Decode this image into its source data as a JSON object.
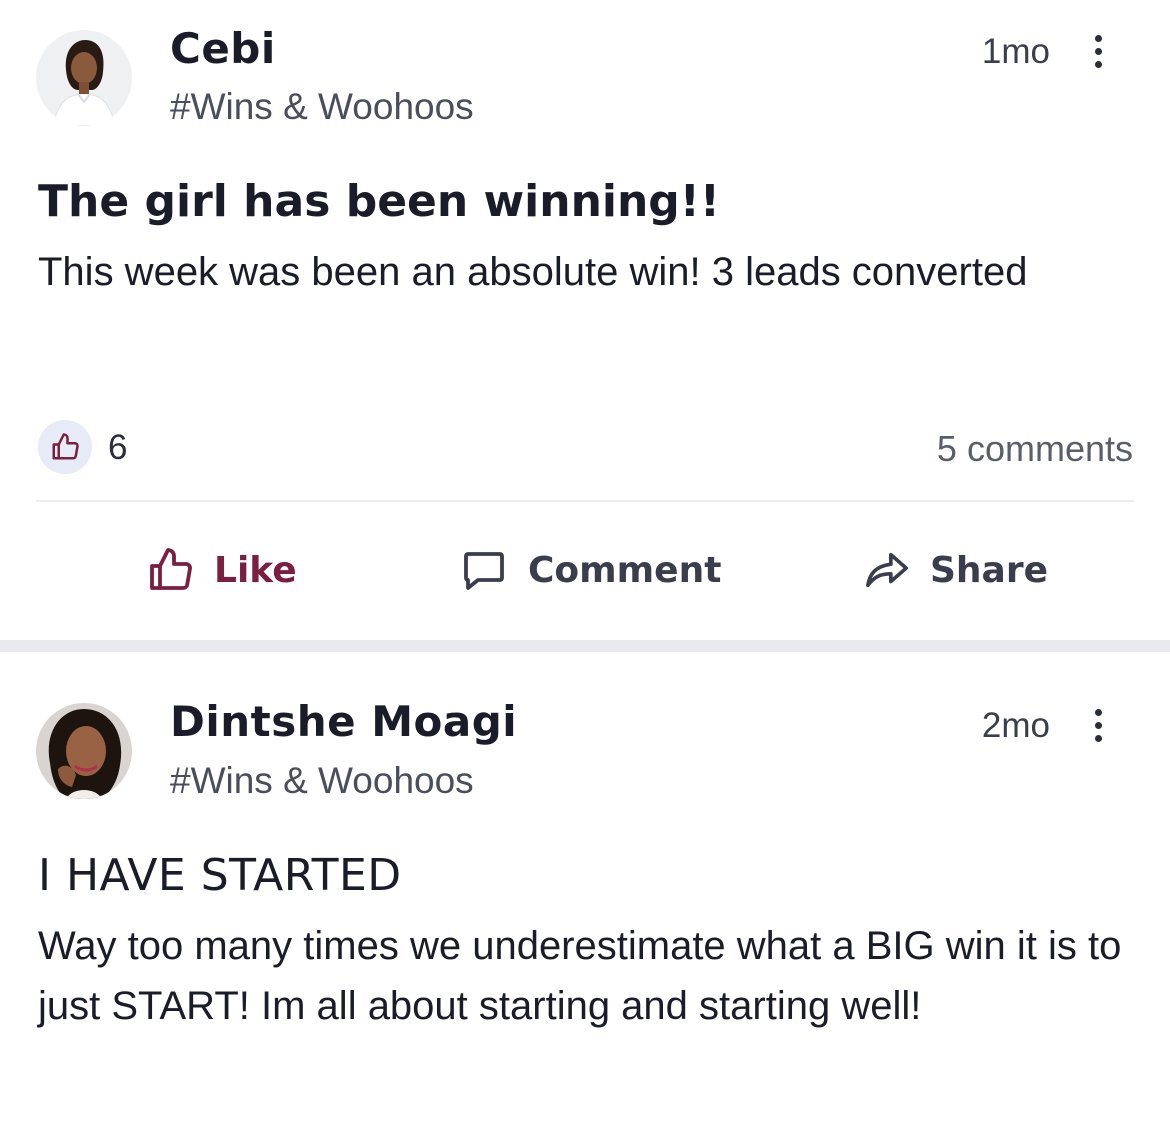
{
  "posts": [
    {
      "author": "Cebi",
      "channel": "#Wins & Woohoos",
      "time": "1mo",
      "title": "The girl has been winning!!",
      "body": "This week was been an absolute win! 3 leads converted",
      "reactions": "6",
      "comments": "5 comments",
      "actions": {
        "like": "Like",
        "comment": "Comment",
        "share": "Share"
      },
      "icons": {
        "reaction": "thumbs-up-icon",
        "more": "vertical-ellipsis-icon"
      }
    },
    {
      "author": "Dintshe Moagi",
      "channel": "#Wins & Woohoos",
      "time": "2mo",
      "title": "I HAVE STARTED",
      "body": "Way too many times we underestimate what a BIG win it is to just START! Im all about starting and starting well!",
      "icons": {
        "more": "vertical-ellipsis-icon"
      }
    }
  ],
  "colors": {
    "accent": "#7a1f3d",
    "reaction_bg": "#e7eaf7",
    "divider": "#e9eaee",
    "text": "#1a1d29",
    "muted": "#4a4e5c"
  }
}
